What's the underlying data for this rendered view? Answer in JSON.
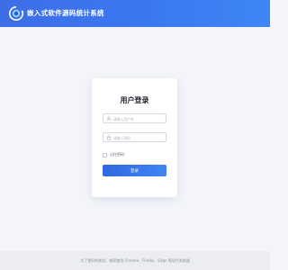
{
  "header": {
    "title": "嵌入式软件源码统计系统",
    "logo_icon": "circular-logo-icon",
    "background": "#3a78f2"
  },
  "login": {
    "title": "用户登录",
    "username": {
      "icon": "user-icon",
      "placeholder": "请输入用户名",
      "value": ""
    },
    "password": {
      "icon": "lock-icon",
      "placeholder": "请输入密码",
      "value": ""
    },
    "remember_label": "记住密码",
    "remember_checked": false,
    "submit_label": "登录",
    "accent_color": "#3a78f2"
  },
  "footer": {
    "text": "为了更好的体验，推荐使用 Chrome、Firefox、Edge 等现代浏览器"
  }
}
